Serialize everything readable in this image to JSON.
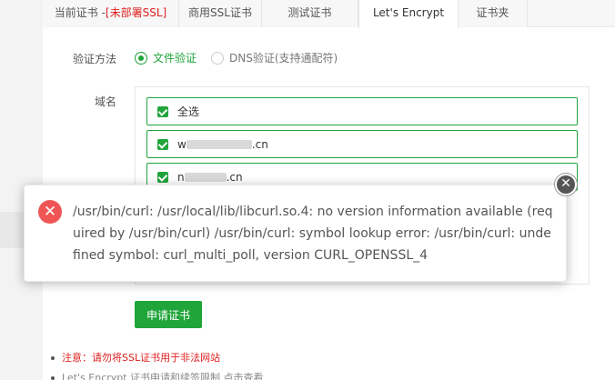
{
  "tabs": {
    "current_label": "当前证书 -",
    "current_status": "[未部署SSL]",
    "commercial": "商用SSL证书",
    "test": "测试证书",
    "letsencrypt": "Let's Encrypt",
    "cert_folder": "证书夹"
  },
  "form": {
    "method_label": "验证方法",
    "method_options": [
      "文件验证",
      "DNS验证(支持通配符)"
    ],
    "method_selected": "文件验证",
    "domain_label": "域名",
    "select_all": "全选",
    "domains": [
      {
        "prefix": "w",
        "suffix": ".cn",
        "checked": true
      },
      {
        "prefix": "n",
        "suffix": ".cn",
        "checked": true
      }
    ],
    "apply_button": "申请证书"
  },
  "notes": {
    "warning": "注意：请勿将SSL证书用于非法网站",
    "info": "Let's Encrypt 证书申请和续签限制 点击查看"
  },
  "error_popup": {
    "icon": "error-icon",
    "message": "/usr/bin/curl: /usr/local/lib/libcurl.so.4: no version information available (required by /usr/bin/curl) /usr/bin/curl: symbol lookup error: /usr/bin/curl: undefined symbol: curl_multi_poll, version CURL_OPENSSL_4",
    "close_icon": "close-icon"
  },
  "colors": {
    "accent": "#20a53a",
    "warning": "#e02020",
    "error": "#f05555"
  }
}
